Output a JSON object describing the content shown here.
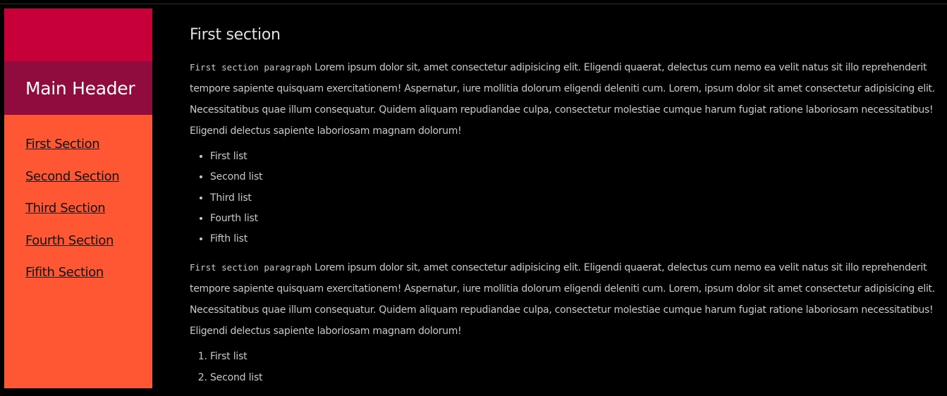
{
  "sidebar": {
    "title": "Main Header",
    "items": [
      {
        "label": "First Section"
      },
      {
        "label": "Second Section"
      },
      {
        "label": "Third Section"
      },
      {
        "label": "Fourth Section"
      },
      {
        "label": "Fifith Section"
      }
    ],
    "colors": {
      "top": "#c70039",
      "header": "#900c3f",
      "nav": "#ff5733"
    }
  },
  "main": {
    "section_title": "First section",
    "paragraph_1": {
      "code": "First section paragraph",
      "text": " Lorem ipsum dolor sit, amet consectetur adipisicing elit. Eligendi quaerat, delectus cum nemo ea velit natus sit illo reprehenderit tempore sapiente quisquam exercitationem! Aspernatur, iure mollitia dolorum eligendi deleniti cum. Lorem, ipsum dolor sit amet consectetur adipisicing elit. Necessitatibus quae illum consequatur. Quidem aliquam repudiandae culpa, consectetur molestiae cumque harum fugiat ratione laboriosam necessitatibus! Eligendi delectus sapiente laboriosam magnam dolorum!"
    },
    "unordered_list": [
      "First list",
      "Second list",
      "Third list",
      "Fourth list",
      "Fifth list"
    ],
    "paragraph_2": {
      "code": "First section paragraph",
      "text": " Lorem ipsum dolor sit, amet consectetur adipisicing elit. Eligendi quaerat, delectus cum nemo ea velit natus sit illo reprehenderit tempore sapiente quisquam exercitationem! Aspernatur, iure mollitia dolorum eligendi deleniti cum. Lorem, ipsum dolor sit amet consectetur adipisicing elit. Necessitatibus quae illum consequatur. Quidem aliquam repudiandae culpa, consectetur molestiae cumque harum fugiat ratione laboriosam necessitatibus! Eligendi delectus sapiente laboriosam magnam dolorum!"
    },
    "ordered_list": [
      "First list",
      "Second list"
    ]
  }
}
